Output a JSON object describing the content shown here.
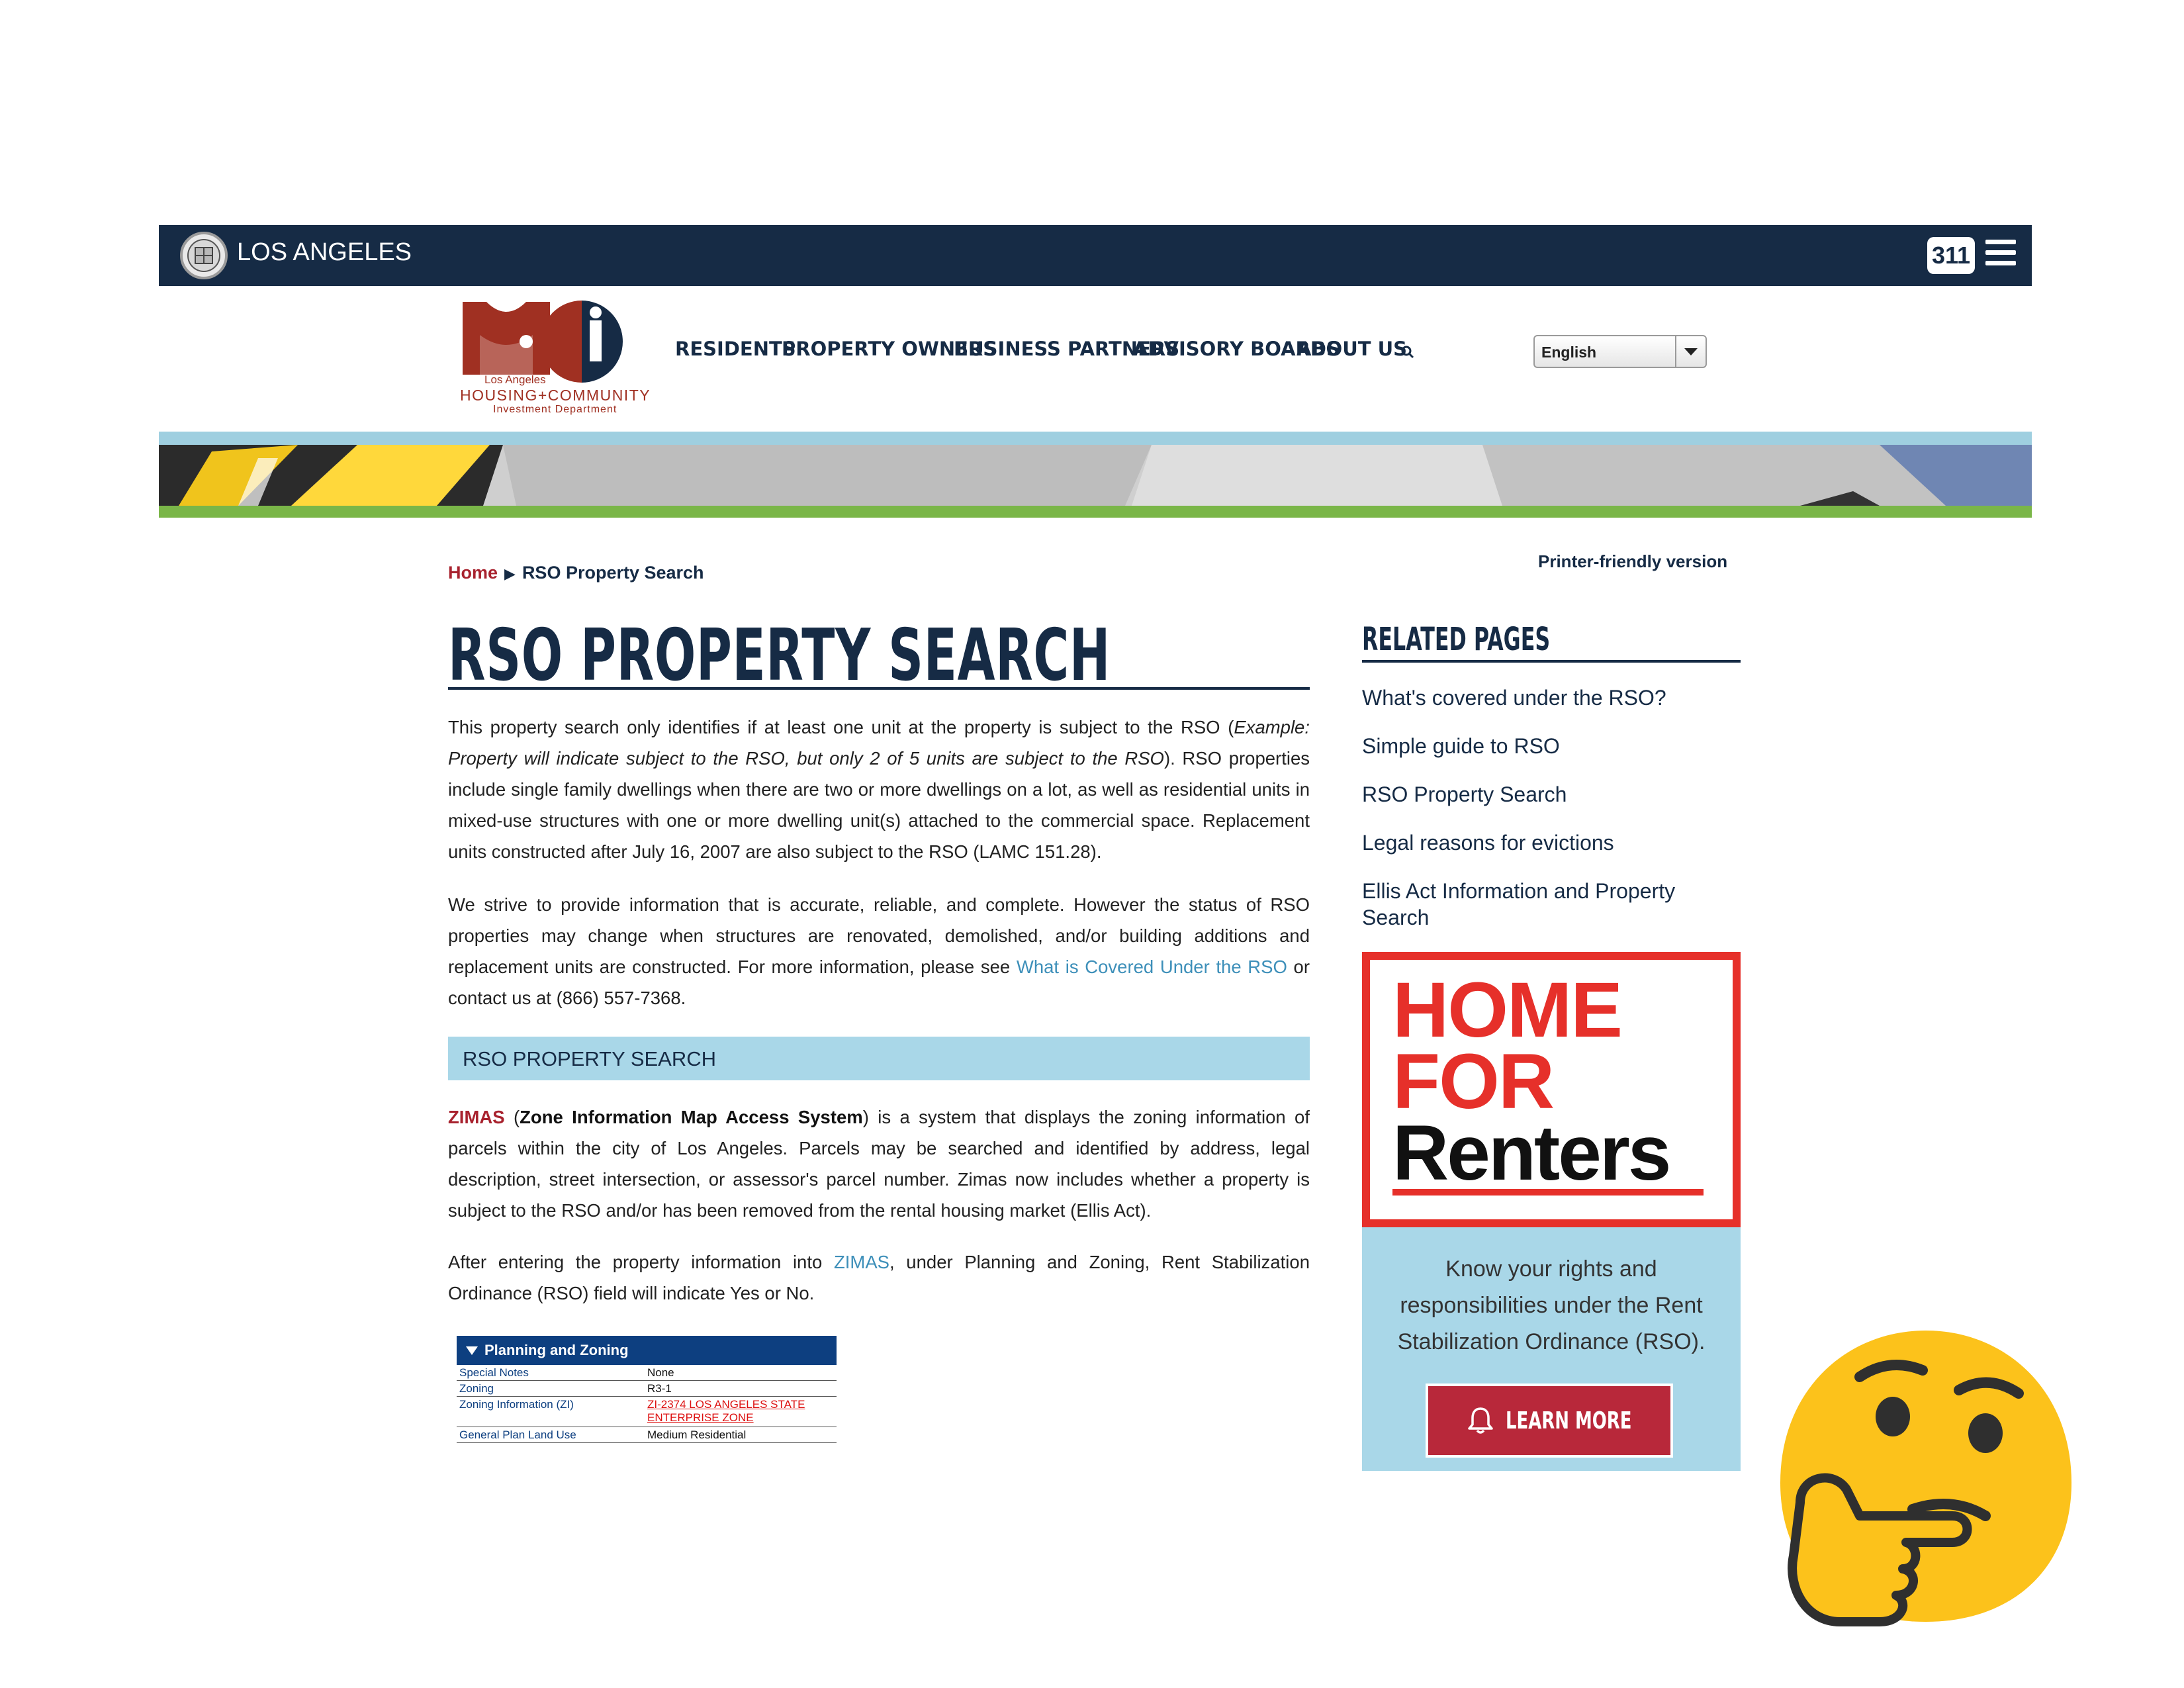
{
  "city_bar": {
    "city_name": "LOS ANGELES",
    "badge": "311",
    "icons": [
      "city-seal-icon",
      "hamburger-menu-icon"
    ],
    "background": "#162b45"
  },
  "header": {
    "logo": {
      "line1": "Los Angeles",
      "line2": "HOUSING+COMMUNITY",
      "line3": "Investment Department"
    },
    "nav": [
      "RESIDENTS",
      "PROPERTY OWNERS",
      "BUSINESS PARTNERS",
      "ADVISORY BOARDS",
      "ABOUT US"
    ],
    "language": {
      "selected": "English"
    }
  },
  "breadcrumb": {
    "home": "Home",
    "separator": "▶",
    "current": "RSO Property Search"
  },
  "printer_link": "Printer-friendly version",
  "main": {
    "title": "RSO PROPERTY SEARCH",
    "p1": {
      "a": "This property search only identifies if at least one unit at the property is subject to the RSO (",
      "italic": "Example: Property will indicate subject to the RSO, but only 2 of 5 units are subject to the RSO",
      "b": "). RSO properties include single family dwellings when there are two or more dwellings on a lot, as well as residential units in mixed-use structures with one or more dwelling unit(s) attached to the commercial space. Replacement units constructed after July 16, 2007 are also subject to the RSO (LAMC 151.28)."
    },
    "p2": {
      "a": "We strive to provide information that is accurate, reliable, and complete. However the status of RSO properties may change when structures are renovated, demolished, and/or building additions and replacement units are constructed. For more information, please see ",
      "link": "What is Covered Under the RSO",
      "b": " or contact us at (866) 557-7368."
    },
    "section_heading": "RSO PROPERTY SEARCH",
    "p3": {
      "zimas": "ZIMAS",
      "open": " (",
      "zimas_full": "Zone Information Map Access System",
      "b": ") is a system that displays the zoning information of parcels within the city of Los Angeles. Parcels may be searched and identified by address, legal description, street intersection, or assessor's parcel number. Zimas now includes whether a property is subject to the RSO and/or has been removed from the rental housing market (Ellis Act)."
    },
    "p4": {
      "a": "After entering the property information into ",
      "link": "ZIMAS",
      "b": ", under Planning and Zoning, Rent Stabilization Ordinance (RSO) field will indicate Yes or No."
    },
    "zimas_preview": {
      "header": "Planning and Zoning",
      "rows": [
        {
          "k": "Special Notes",
          "v": "None",
          "link": false
        },
        {
          "k": "Zoning",
          "v": "R3-1",
          "link": false
        },
        {
          "k": "Zoning Information (ZI)",
          "v": "ZI-2374 LOS ANGELES STATE ENTERPRISE ZONE",
          "link": true
        },
        {
          "k": "General Plan Land Use",
          "v": "Medium Residential",
          "link": false
        }
      ]
    }
  },
  "sidebar": {
    "related_title": "RELATED PAGES",
    "links": [
      "What's covered under the RSO?",
      "Simple guide to RSO",
      "RSO Property Search",
      "Legal reasons for evictions",
      "Ellis Act Information and Property Search"
    ],
    "promo": {
      "line1": "HOME",
      "line2": "FOR",
      "line3": "Renters",
      "text": "Know your rights and responsibilities under the Rent Stabilization Ordinance (RSO).",
      "button": "LEARN MORE"
    }
  },
  "colors": {
    "navy": "#162b45",
    "link_red": "#a8222e",
    "link_blue": "#3d8fb9",
    "section_blue": "#a9d7e8",
    "promo_red": "#e6302a",
    "button_red": "#b8283a"
  }
}
